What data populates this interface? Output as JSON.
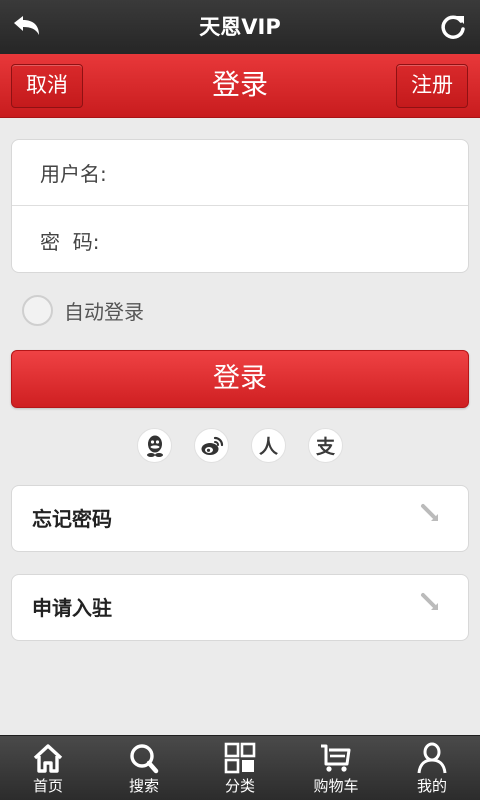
{
  "topbar": {
    "title": "天恩VIP"
  },
  "header": {
    "cancel_label": "取消",
    "title": "登录",
    "register_label": "注册"
  },
  "form": {
    "username_label": "用户名:",
    "username_value": "",
    "password_label": "密  码:",
    "password_value": ""
  },
  "auto_login": {
    "label": "自动登录",
    "checked": false
  },
  "login_button": {
    "label": "登录"
  },
  "social": [
    {
      "name": "qq-icon"
    },
    {
      "name": "weibo-icon"
    },
    {
      "name": "renren-icon",
      "glyph": "人"
    },
    {
      "name": "alipay-icon",
      "glyph": "支"
    }
  ],
  "links": {
    "forgot_password": "忘记密码",
    "apply_join": "申请入驻"
  },
  "tabbar": {
    "items": [
      {
        "label": "首页",
        "icon": "home-icon"
      },
      {
        "label": "搜索",
        "icon": "search-icon"
      },
      {
        "label": "分类",
        "icon": "category-icon"
      },
      {
        "label": "购物车",
        "icon": "cart-icon"
      },
      {
        "label": "我的",
        "icon": "user-icon"
      }
    ]
  }
}
